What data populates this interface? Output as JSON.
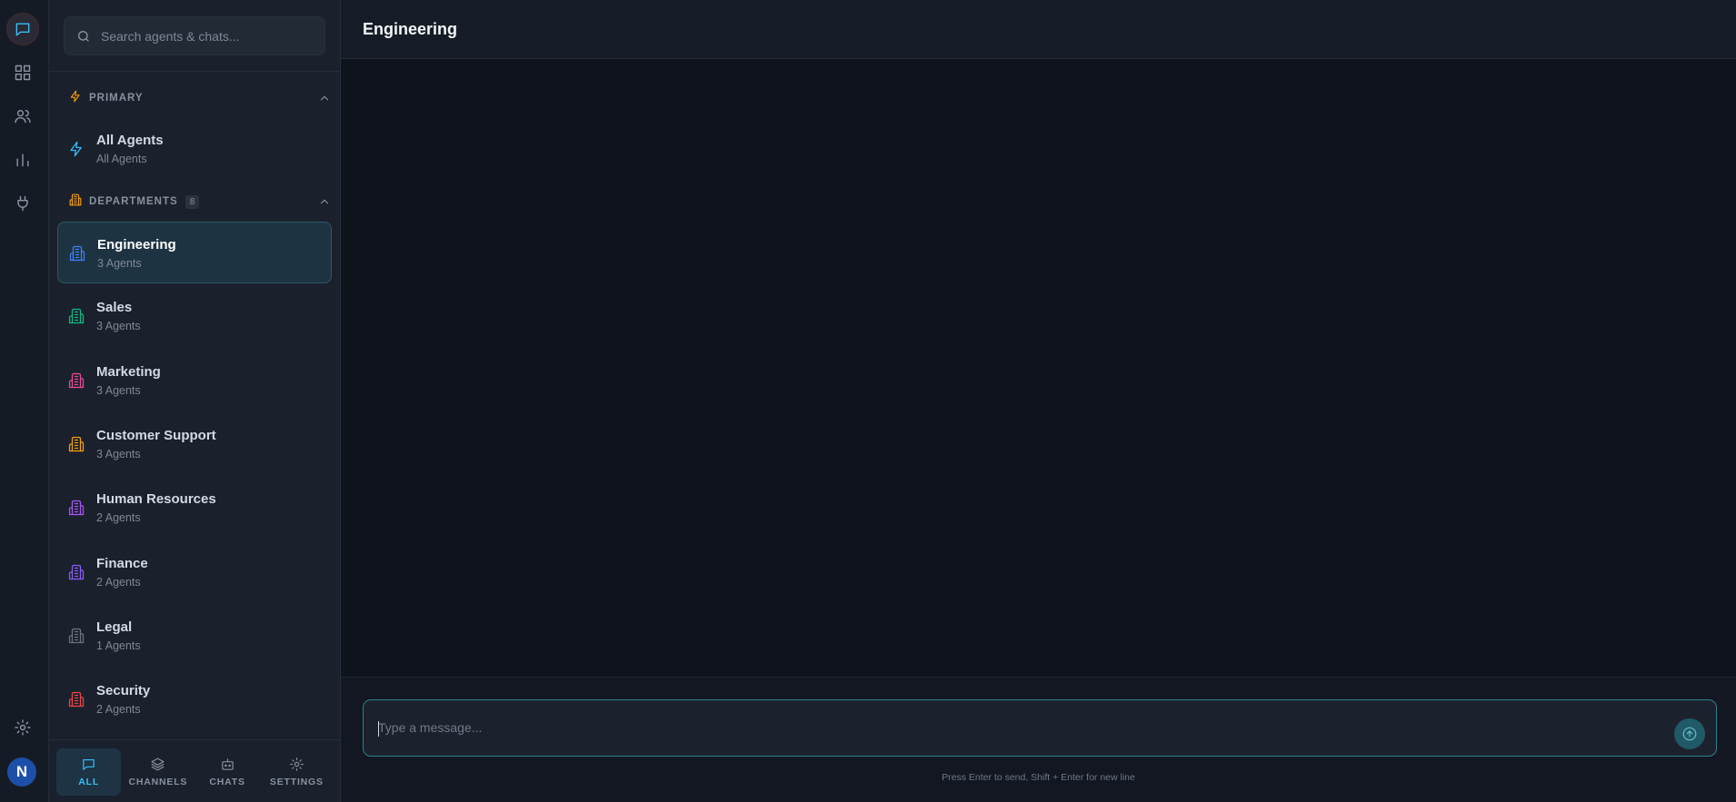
{
  "rail": {
    "items": [
      {
        "icon": "chat-icon",
        "active": true
      },
      {
        "icon": "dashboard-grid-icon",
        "active": false
      },
      {
        "icon": "users-icon",
        "active": false
      },
      {
        "icon": "bar-chart-icon",
        "active": false
      },
      {
        "icon": "plug-icon",
        "active": false
      }
    ],
    "settings_icon": "gear-icon",
    "avatar_initial": "N",
    "avatar_color": "#1e4fa8"
  },
  "search": {
    "placeholder": "Search agents & chats..."
  },
  "primary": {
    "title": "PRIMARY",
    "color": "#f59e0b",
    "items": [
      {
        "title": "All Agents",
        "subtitle": "All Agents",
        "icon": "lightning-icon",
        "color": "#38bdf8"
      }
    ]
  },
  "departments": {
    "title": "DEPARTMENTS",
    "count": "8",
    "color": "#f59e0b",
    "items": [
      {
        "title": "Engineering",
        "subtitle": "3 Agents",
        "color": "#3b82f6",
        "selected": true
      },
      {
        "title": "Sales",
        "subtitle": "3 Agents",
        "color": "#10b981"
      },
      {
        "title": "Marketing",
        "subtitle": "3 Agents",
        "color": "#ec4899"
      },
      {
        "title": "Customer Support",
        "subtitle": "3 Agents",
        "color": "#f59e0b"
      },
      {
        "title": "Human Resources",
        "subtitle": "2 Agents",
        "color": "#a855f7"
      },
      {
        "title": "Finance",
        "subtitle": "2 Agents",
        "color": "#8b5cf6"
      },
      {
        "title": "Legal",
        "subtitle": "1 Agents",
        "color": "#6b7280"
      },
      {
        "title": "Security",
        "subtitle": "2 Agents",
        "color": "#ef4444"
      }
    ]
  },
  "tabs": [
    {
      "label": "ALL",
      "icon": "chat-icon",
      "active": true
    },
    {
      "label": "CHANNELS",
      "icon": "layers-icon",
      "active": false
    },
    {
      "label": "CHATS",
      "icon": "bot-icon",
      "active": false
    },
    {
      "label": "SETTINGS",
      "icon": "gear-icon",
      "active": false
    }
  ],
  "main": {
    "title": "Engineering",
    "composer_placeholder": "Type a message...",
    "hint": "Press Enter to send, Shift + Enter for new line",
    "accent": "#2d7f8c"
  }
}
